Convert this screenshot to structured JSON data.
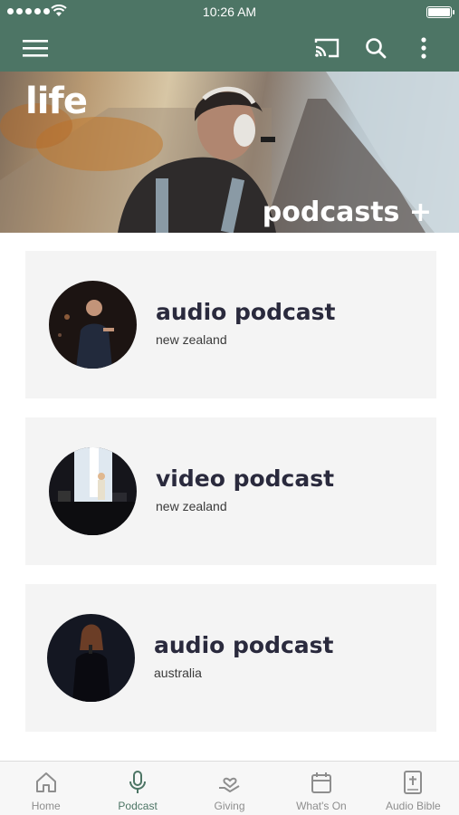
{
  "status_bar": {
    "time": "10:26 AM"
  },
  "hero": {
    "logo_text": "life",
    "title": "podcasts +"
  },
  "podcasts": [
    {
      "title": "audio podcast",
      "subtitle": "new zealand",
      "thumb_icon": "speaker-photo"
    },
    {
      "title": "video podcast",
      "subtitle": "new zealand",
      "thumb_icon": "stage-photo"
    },
    {
      "title": "audio podcast",
      "subtitle": "australia",
      "thumb_icon": "singer-photo"
    }
  ],
  "tabs": [
    {
      "label": "Home",
      "icon": "home-icon"
    },
    {
      "label": "Podcast",
      "icon": "microphone-icon",
      "active": true
    },
    {
      "label": "Giving",
      "icon": "giving-icon"
    },
    {
      "label": "What's On",
      "icon": "calendar-icon"
    },
    {
      "label": "Audio Bible",
      "icon": "bible-icon"
    }
  ],
  "colors": {
    "primary": "#4d7565",
    "card_bg": "#f4f4f4",
    "inactive_tab": "#8e8e8e"
  }
}
